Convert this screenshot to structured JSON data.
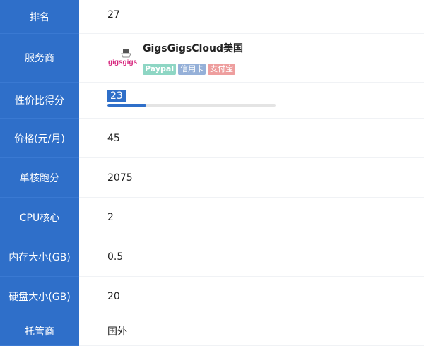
{
  "rows": {
    "rank": {
      "label": "排名",
      "value": "27"
    },
    "provider": {
      "label": "服务商",
      "name": "GigsGigsCloud美国",
      "logo_text": "gigsgigs",
      "tags": {
        "paypal": "Paypal",
        "card": "信用卡",
        "alipay": "支付宝"
      }
    },
    "score": {
      "label": "性价比得分",
      "value": "23",
      "max": 100
    },
    "price": {
      "label": "价格(元/月)",
      "value": "45"
    },
    "single_core": {
      "label": "单核跑分",
      "value": "2075"
    },
    "cpu": {
      "label": "CPU核心",
      "value": "2"
    },
    "memory": {
      "label": "内存大小(GB)",
      "value": "0.5"
    },
    "disk": {
      "label": "硬盘大小(GB)",
      "value": "20"
    },
    "host": {
      "label": "托管商",
      "value": "国外"
    }
  },
  "colors": {
    "label_bg": "#2f6fc9",
    "paypal_tag": "#8ed6c4",
    "card_tag": "#95b0d8",
    "alipay_tag": "#ee9e9e",
    "logo_pink": "#d6247c"
  },
  "icons": {
    "provider_logo": "gigsgigscloud-logo"
  }
}
